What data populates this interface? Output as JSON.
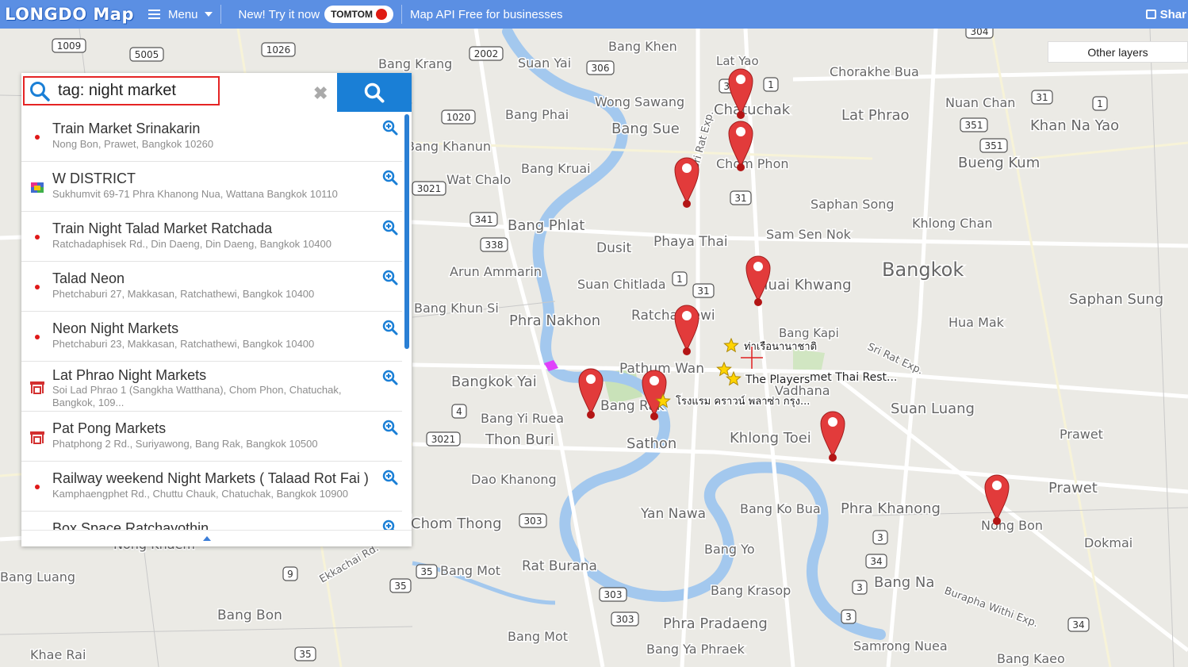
{
  "topbar": {
    "logo": "LONGDO Map",
    "menu_label": "Menu",
    "promo_text": "New! Try it now",
    "tomtom_label": "TOMTOM",
    "api_link": "Map API Free for businesses",
    "share_label": "Shar"
  },
  "layers": {
    "other_layers_label": "Other layers"
  },
  "search": {
    "query": "tag: night market",
    "clear_icon": "close-icon",
    "search_icon": "search-icon"
  },
  "results": [
    {
      "title": "Train Market Srinakarin",
      "address": "Nong Bon, Prawet, Bangkok 10260",
      "icon": "red-dot-icon"
    },
    {
      "title": "W DISTRICT",
      "address": "Sukhumvit 69-71 Phra Khanong Nua, Wattana Bangkok 10110",
      "icon": "shopping-icon"
    },
    {
      "title": "Train Night Talad Market Ratchada",
      "address": "Ratchadaphisek Rd., Din Daeng, Din Daeng, Bangkok 10400",
      "icon": "red-dot-icon"
    },
    {
      "title": "Talad Neon",
      "address": "Phetchaburi 27, Makkasan, Ratchathewi, Bangkok 10400",
      "icon": "red-dot-icon"
    },
    {
      "title": "Neon Night Markets",
      "address": "Phetchaburi 23, Makkasan, Ratchathewi, Bangkok 10400",
      "icon": "red-dot-icon"
    },
    {
      "title": "Lat Phrao Night Markets",
      "address": "Soi Lad Phrao 1 (Sangkha Watthana), Chom Phon, Chatuchak, Bangkok, 109...",
      "icon": "market-icon"
    },
    {
      "title": "Pat Pong Markets",
      "address": "Phatphong 2 Rd., Suriyawong, Bang Rak, Bangkok 10500",
      "icon": "market-icon"
    },
    {
      "title": "Railway weekend Night Markets ( Talaad Rot Fai )",
      "address": "Kamphaengphet Rd., Chuttu Chauk, Chatuchak, Bangkok 10900",
      "icon": "red-dot-icon"
    },
    {
      "title": "Box Space Ratchayothin",
      "address": "",
      "icon": "shopping-icon"
    }
  ],
  "map": {
    "labels": [
      {
        "t": "Bangkok"
      },
      {
        "t": "Lat Yao"
      },
      {
        "t": "Chorakhe Bua"
      },
      {
        "t": "Nuan Chan"
      },
      {
        "t": "Khan Na Yao"
      },
      {
        "t": "Bang Khen"
      },
      {
        "t": "Wong Sawang"
      },
      {
        "t": "Bang Phai"
      },
      {
        "t": "Bang Sue"
      },
      {
        "t": "Lat Phrao"
      },
      {
        "t": "Chatuchak"
      },
      {
        "t": "Chom Phon"
      },
      {
        "t": "Bueng Kum"
      },
      {
        "t": "Bang Krang"
      },
      {
        "t": "Suan Yai"
      },
      {
        "t": "Bang Khanun"
      },
      {
        "t": "Bang Kruai"
      },
      {
        "t": "Wat Chalo"
      },
      {
        "t": "Saphan Song"
      },
      {
        "t": "Khlong Chan"
      },
      {
        "t": "Bang Phlat"
      },
      {
        "t": "Dusit"
      },
      {
        "t": "Phaya Thai"
      },
      {
        "t": "Sam Sen Nok"
      },
      {
        "t": "Huai Khwang"
      },
      {
        "t": "Arun Ammarin"
      },
      {
        "t": "Suan Chitlada"
      },
      {
        "t": "Saphan Sung"
      },
      {
        "t": "Bang Khun Si"
      },
      {
        "t": "Phra Nakhon"
      },
      {
        "t": "Ratchathewi"
      },
      {
        "t": "Bang Kapi"
      },
      {
        "t": "Hua Mak"
      },
      {
        "t": "Pathum Wan"
      },
      {
        "t": "Bangkok Yai"
      },
      {
        "t": "Bang Rak"
      },
      {
        "t": "Vadhana"
      },
      {
        "t": "Suan Luang"
      },
      {
        "t": "Prawet"
      },
      {
        "t": "Bang Yi Ruea"
      },
      {
        "t": "Thon Buri"
      },
      {
        "t": "Sathon"
      },
      {
        "t": "Khlong Toei"
      },
      {
        "t": "Dao Khanong"
      },
      {
        "t": "Yan Nawa"
      },
      {
        "t": "Bang Ko Bua"
      },
      {
        "t": "Phra Khanong"
      },
      {
        "t": "Nong Bon"
      },
      {
        "t": "Dokmai"
      },
      {
        "t": "Chom Thong"
      },
      {
        "t": "Bang Yo"
      },
      {
        "t": "Bang Mot"
      },
      {
        "t": "Rat Burana"
      },
      {
        "t": "Bang Krasop"
      },
      {
        "t": "Bang Na"
      },
      {
        "t": "Bang Bon"
      },
      {
        "t": "Phra Pradaeng"
      },
      {
        "t": "Samrong Nuea"
      },
      {
        "t": "Bang Kaeo"
      },
      {
        "t": "Bang Ya Phraek"
      },
      {
        "t": "Khae Rai"
      },
      {
        "t": "Nong Khaem"
      },
      {
        "t": "Ekkachai Rd."
      },
      {
        "t": "Burapha Withi Exp."
      },
      {
        "t": "Sri Rat Exp."
      },
      {
        "t": "Sri Rat Exp."
      },
      {
        "t": "Prawet"
      },
      {
        "t": "Bang Luang"
      },
      {
        "t": "Bang Mot"
      },
      {
        "t": "ท่าเรือนานาชาติ"
      },
      {
        "t": "The Players"
      },
      {
        "t": "met Thai Rest..."
      },
      {
        "t": "โรงแรม คราวน์ พลาซ่า กรุง..."
      }
    ],
    "shields": [
      "304",
      "31",
      "1",
      "351",
      "351",
      "306",
      "2002",
      "302",
      "304",
      "31",
      "1",
      "31",
      "341",
      "338",
      "1",
      "31",
      "4",
      "303",
      "3",
      "34",
      "3",
      "3",
      "34",
      "9",
      "35",
      "35",
      "303",
      "303",
      "35",
      "3021",
      "1020",
      "1009",
      "5005",
      "1026",
      "3021"
    ]
  }
}
